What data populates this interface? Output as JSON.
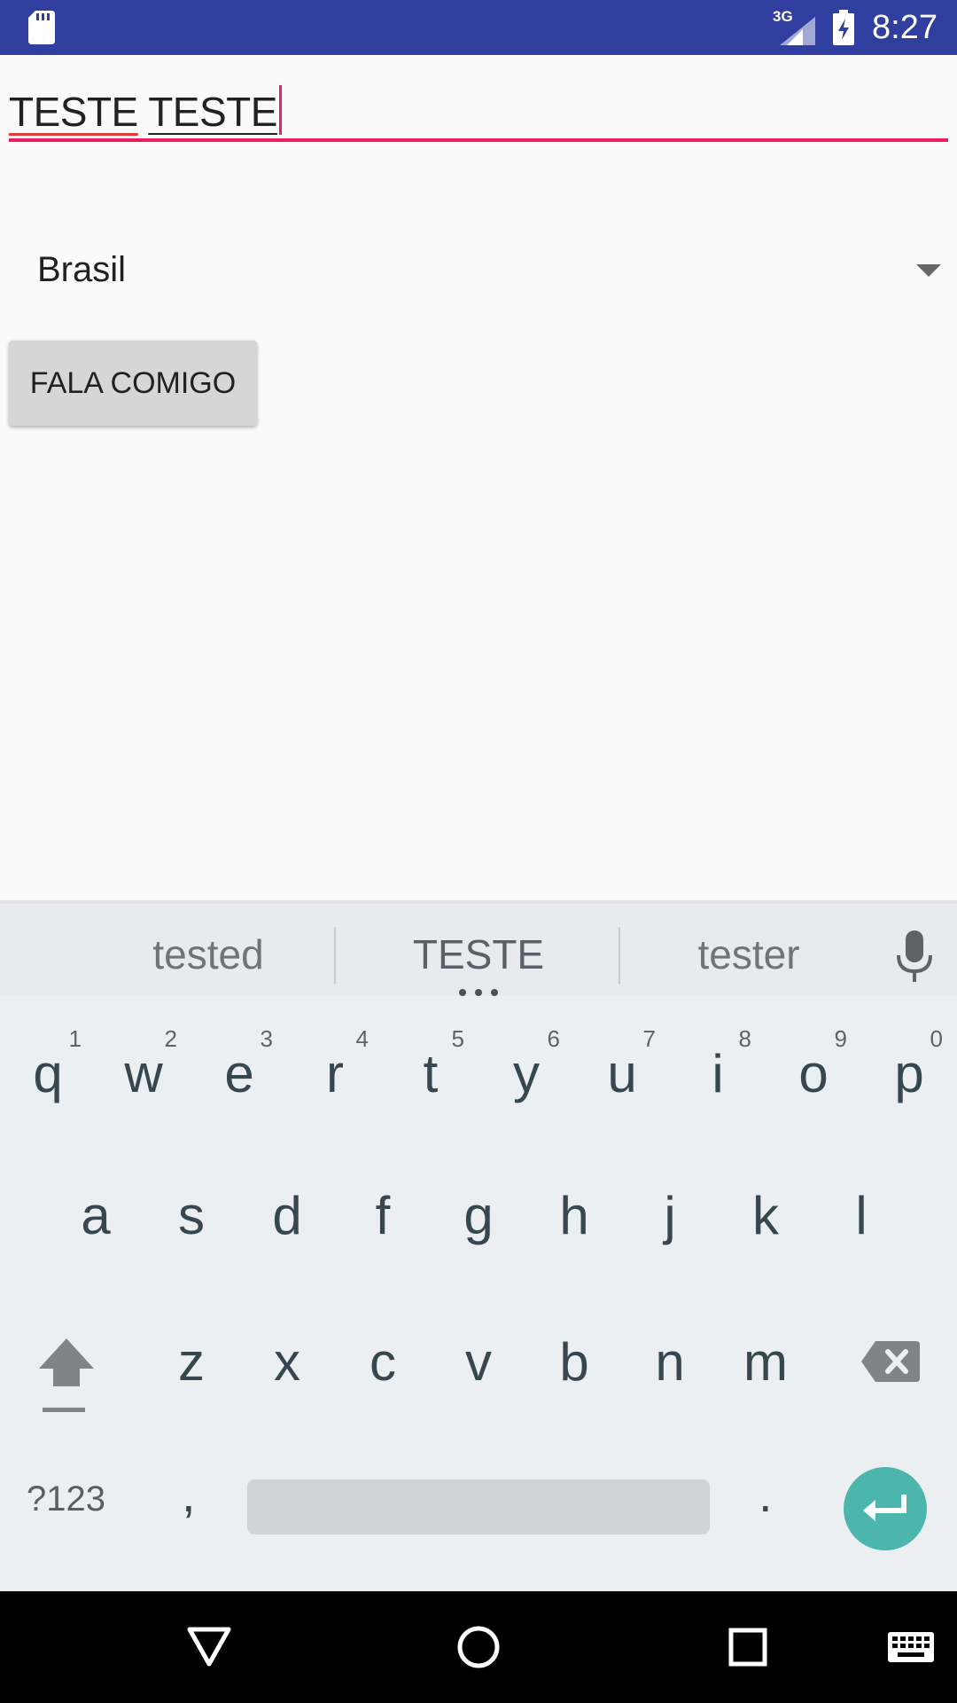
{
  "status_bar": {
    "network_type": "3G",
    "time": "8:27",
    "icons": [
      "sd-card-icon",
      "signal-icon",
      "battery-charging-icon"
    ]
  },
  "text_field": {
    "word1": "TESTE",
    "word2": "TESTE",
    "accent_color": "#e91e63"
  },
  "spinner": {
    "selected": "Brasil"
  },
  "button": {
    "label": "FALA COMIGO"
  },
  "keyboard": {
    "suggestions": [
      "tested",
      "TESTE",
      "tester"
    ],
    "row1": [
      {
        "key": "q",
        "hint": "1"
      },
      {
        "key": "w",
        "hint": "2"
      },
      {
        "key": "e",
        "hint": "3"
      },
      {
        "key": "r",
        "hint": "4"
      },
      {
        "key": "t",
        "hint": "5"
      },
      {
        "key": "y",
        "hint": "6"
      },
      {
        "key": "u",
        "hint": "7"
      },
      {
        "key": "i",
        "hint": "8"
      },
      {
        "key": "o",
        "hint": "9"
      },
      {
        "key": "p",
        "hint": "0"
      }
    ],
    "row2": [
      "a",
      "s",
      "d",
      "f",
      "g",
      "h",
      "j",
      "k",
      "l"
    ],
    "row3": [
      "z",
      "x",
      "c",
      "v",
      "b",
      "n",
      "m"
    ],
    "symbols_label": "?123",
    "comma": ",",
    "period": ".",
    "enter_color": "#4db6ac"
  },
  "nav_bar": {
    "icons": [
      "back-icon",
      "home-icon",
      "recents-icon",
      "keyboard-switch-icon"
    ]
  }
}
